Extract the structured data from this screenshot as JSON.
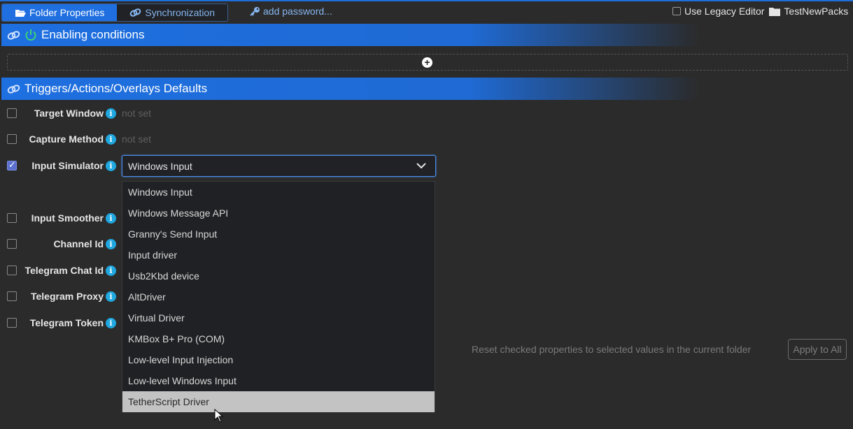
{
  "tabs": [
    {
      "label": "Folder Properties",
      "icon": "folder-open-icon",
      "active": true
    },
    {
      "label": "Synchronization",
      "icon": "link-icon",
      "active": false
    }
  ],
  "add_password": {
    "label": "add password...",
    "icon": "key-icon"
  },
  "legacy_editor": {
    "label": "Use Legacy Editor",
    "checked": false
  },
  "folder": {
    "name": "TestNewPacks",
    "icon": "folder-icon"
  },
  "sections": {
    "enabling": {
      "title": "Enabling conditions",
      "icons": [
        "link-icon",
        "power-icon"
      ]
    },
    "defaults": {
      "title": "Triggers/Actions/Overlays Defaults",
      "icon": "link-icon"
    }
  },
  "properties": [
    {
      "label": "Target Window",
      "checked": false,
      "value": "not set"
    },
    {
      "label": "Capture Method",
      "checked": false,
      "value": "not set"
    },
    {
      "label": "Input Simulator",
      "checked": true,
      "value": "Windows Input"
    },
    {
      "label": "Input Smoother",
      "checked": false
    },
    {
      "label": "Channel Id",
      "checked": false
    },
    {
      "label": "Telegram Chat Id",
      "checked": false
    },
    {
      "label": "Telegram Proxy",
      "checked": false
    },
    {
      "label": "Telegram Token",
      "checked": false
    }
  ],
  "input_simulator_options": [
    "Windows Input",
    "Windows Message API",
    "Granny's Send Input",
    "Input driver",
    "Usb2Kbd device",
    "AltDriver",
    "Virtual Driver",
    "KMBox B+ Pro (COM)",
    "Low-level Input Injection",
    "Low-level Windows Input",
    "TetherScript Driver"
  ],
  "highlighted_option": "TetherScript Driver",
  "footer": {
    "reset_text": "Reset checked properties to selected values in the current folder",
    "apply_label": "Apply to All"
  },
  "colors": {
    "accent": "#1f6fe0",
    "info": "#1fa7e0",
    "link": "#86b5ee"
  }
}
